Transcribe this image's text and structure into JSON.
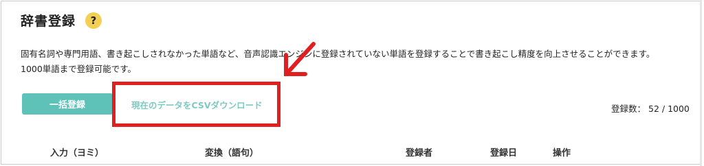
{
  "page": {
    "title": "辞書登録",
    "help_icon": "?",
    "description_line1": "固有名詞や専門用語、書き起こしされなかった単語など、音声認識エンジンに登録されていない単語を登録することで書き起こし精度を向上させることができます。",
    "description_line2": "1000単語まで登録可能です。"
  },
  "actions": {
    "bulk_register_label": "一括登録",
    "csv_download_label": "現在のデータをCSVダウンロード"
  },
  "registration_count": {
    "label": "登録数：",
    "value": "52 / 1000"
  },
  "table": {
    "columns": [
      "入力（ヨミ）",
      "変換（語句）",
      "登録者",
      "登録日",
      "操作"
    ]
  },
  "colors": {
    "accent": "#5fc2b9",
    "link": "#7fc9c2",
    "help_icon_bg": "#f3cf53",
    "annotation_red": "#e02020"
  }
}
